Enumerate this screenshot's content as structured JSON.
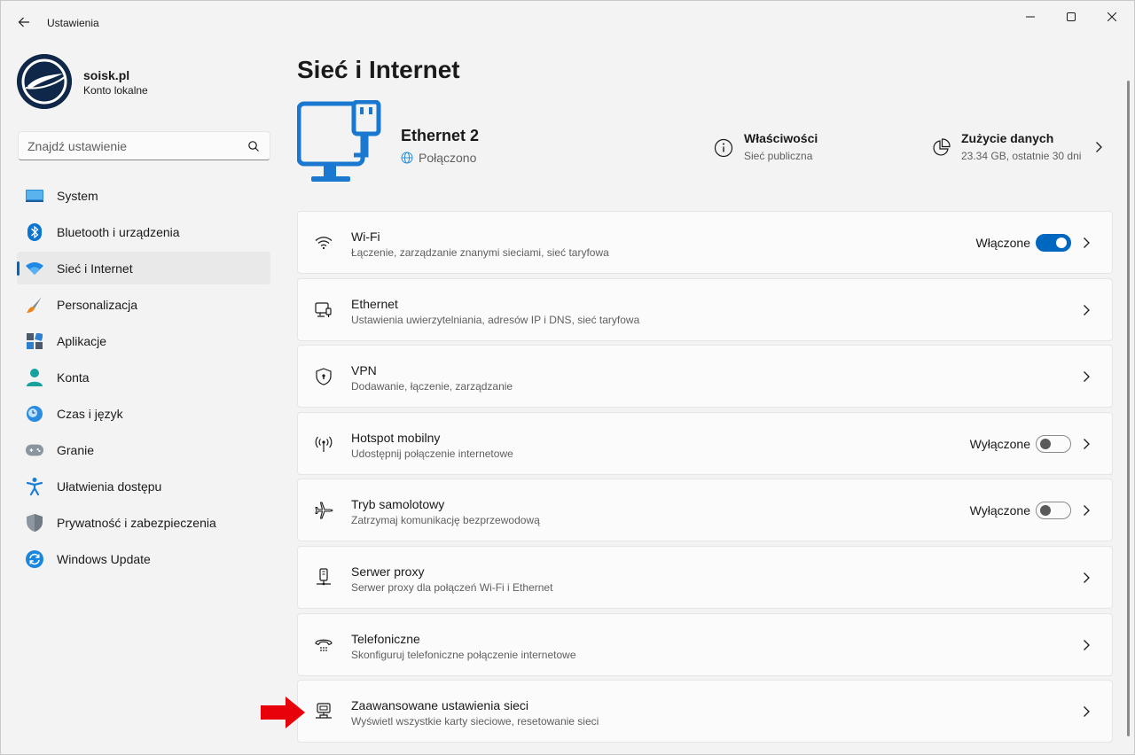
{
  "window": {
    "title": "Ustawienia"
  },
  "profile": {
    "name": "soisk.pl",
    "type": "Konto lokalne"
  },
  "search": {
    "placeholder": "Znajdź ustawienie"
  },
  "nav": {
    "items": [
      {
        "label": "System",
        "icon": "system-icon"
      },
      {
        "label": "Bluetooth i urządzenia",
        "icon": "bluetooth-icon"
      },
      {
        "label": "Sieć i Internet",
        "icon": "wifi-icon",
        "active": true
      },
      {
        "label": "Personalizacja",
        "icon": "brush-icon"
      },
      {
        "label": "Aplikacje",
        "icon": "apps-icon"
      },
      {
        "label": "Konta",
        "icon": "person-icon"
      },
      {
        "label": "Czas i język",
        "icon": "clock-globe-icon"
      },
      {
        "label": "Granie",
        "icon": "gamepad-icon"
      },
      {
        "label": "Ułatwienia dostępu",
        "icon": "accessibility-icon"
      },
      {
        "label": "Prywatność i zabezpieczenia",
        "icon": "shield-icon"
      },
      {
        "label": "Windows Update",
        "icon": "update-icon"
      }
    ]
  },
  "main": {
    "title": "Sieć i Internet",
    "hero": {
      "name": "Ethernet 2",
      "status": "Połączono",
      "properties": {
        "title": "Właściwości",
        "sub": "Sieć publiczna"
      },
      "data_usage": {
        "title": "Zużycie danych",
        "sub": "23.34 GB, ostatnie 30 dni"
      }
    },
    "cards": [
      {
        "title": "Wi-Fi",
        "sub": "Łączenie, zarządzanie znanymi sieciami, sieć taryfowa",
        "toggle_label": "Włączone",
        "toggle": "on",
        "icon": "wifi-icon"
      },
      {
        "title": "Ethernet",
        "sub": "Ustawienia uwierzytelniania, adresów IP i DNS, sieć taryfowa",
        "icon": "ethernet-icon"
      },
      {
        "title": "VPN",
        "sub": "Dodawanie, łączenie, zarządzanie",
        "icon": "vpn-shield-icon"
      },
      {
        "title": "Hotspot mobilny",
        "sub": "Udostępnij połączenie internetowe",
        "toggle_label": "Wyłączone",
        "toggle": "off",
        "icon": "hotspot-icon"
      },
      {
        "title": "Tryb samolotowy",
        "sub": "Zatrzymaj komunikację bezprzewodową",
        "toggle_label": "Wyłączone",
        "toggle": "off",
        "icon": "airplane-icon"
      },
      {
        "title": "Serwer proxy",
        "sub": "Serwer proxy dla połączeń Wi-Fi i Ethernet",
        "icon": "proxy-icon"
      },
      {
        "title": "Telefoniczne",
        "sub": "Skonfiguruj telefoniczne połączenie internetowe",
        "icon": "dialup-icon"
      },
      {
        "title": "Zaawansowane ustawienia sieci",
        "sub": "Wyświetl wszystkie karty sieciowe, resetowanie sieci",
        "icon": "network-adapter-icon"
      }
    ]
  },
  "colors": {
    "accent": "#0067c0",
    "background": "#f3f3f3",
    "card": "#fbfbfb",
    "arrow": "#e8000b"
  }
}
